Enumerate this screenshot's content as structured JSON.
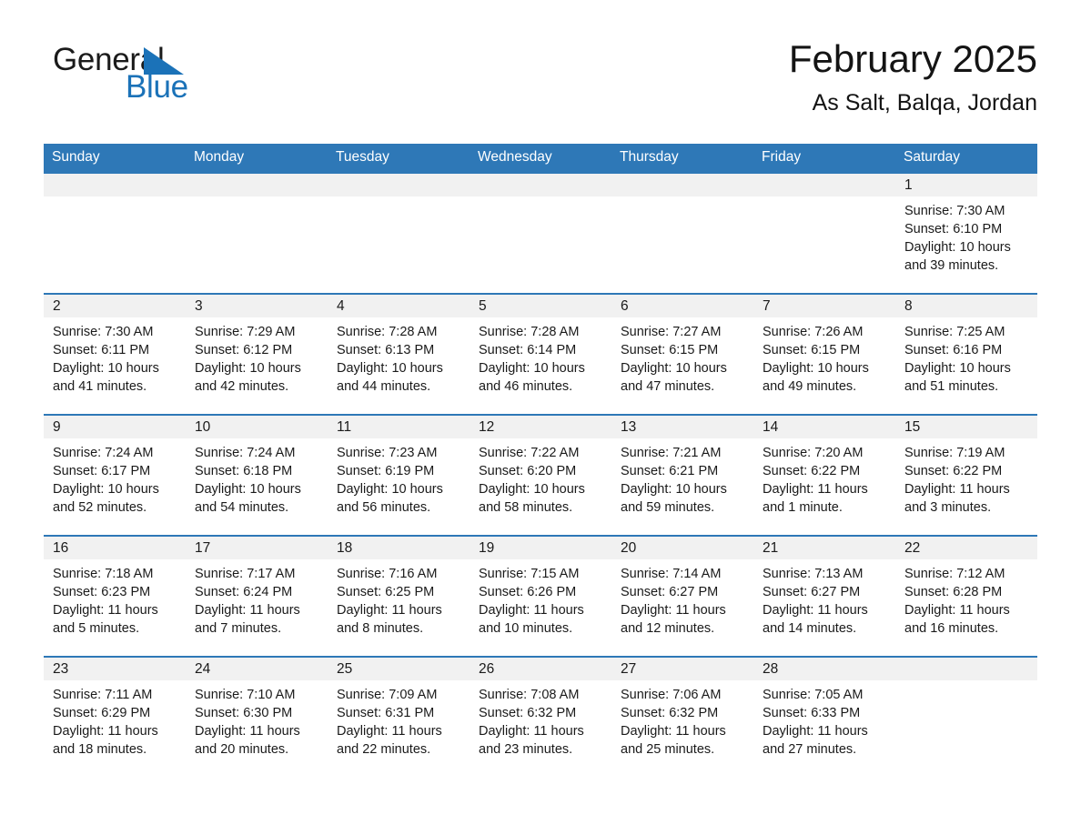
{
  "brand": {
    "name_part1": "General",
    "name_part2": "Blue",
    "triangle_color": "#1b72b8",
    "text_color": "#1b1b1b"
  },
  "header": {
    "title": "February 2025",
    "subtitle": "As Salt, Balqa, Jordan"
  },
  "theme": {
    "header_blue": "#2e78b7",
    "row_divider_blue": "#2e78b7",
    "daynum_band_gray": "#f1f1f1",
    "text_black": "#1a1a1a",
    "page_background": "#ffffff"
  },
  "weekday_headers": [
    "Sunday",
    "Monday",
    "Tuesday",
    "Wednesday",
    "Thursday",
    "Friday",
    "Saturday"
  ],
  "labels": {
    "sunrise_prefix": "Sunrise:",
    "sunset_prefix": "Sunset:",
    "daylight_prefix": "Daylight:"
  },
  "weeks": [
    [
      {
        "empty": true
      },
      {
        "empty": true
      },
      {
        "empty": true
      },
      {
        "empty": true
      },
      {
        "empty": true
      },
      {
        "empty": true
      },
      {
        "empty": false,
        "day": "1",
        "sunrise": "Sunrise: 7:30 AM",
        "sunset": "Sunset: 6:10 PM",
        "daylight_line1": "Daylight: 10 hours",
        "daylight_line2": "and 39 minutes."
      }
    ],
    [
      {
        "empty": false,
        "day": "2",
        "sunrise": "Sunrise: 7:30 AM",
        "sunset": "Sunset: 6:11 PM",
        "daylight_line1": "Daylight: 10 hours",
        "daylight_line2": "and 41 minutes."
      },
      {
        "empty": false,
        "day": "3",
        "sunrise": "Sunrise: 7:29 AM",
        "sunset": "Sunset: 6:12 PM",
        "daylight_line1": "Daylight: 10 hours",
        "daylight_line2": "and 42 minutes."
      },
      {
        "empty": false,
        "day": "4",
        "sunrise": "Sunrise: 7:28 AM",
        "sunset": "Sunset: 6:13 PM",
        "daylight_line1": "Daylight: 10 hours",
        "daylight_line2": "and 44 minutes."
      },
      {
        "empty": false,
        "day": "5",
        "sunrise": "Sunrise: 7:28 AM",
        "sunset": "Sunset: 6:14 PM",
        "daylight_line1": "Daylight: 10 hours",
        "daylight_line2": "and 46 minutes."
      },
      {
        "empty": false,
        "day": "6",
        "sunrise": "Sunrise: 7:27 AM",
        "sunset": "Sunset: 6:15 PM",
        "daylight_line1": "Daylight: 10 hours",
        "daylight_line2": "and 47 minutes."
      },
      {
        "empty": false,
        "day": "7",
        "sunrise": "Sunrise: 7:26 AM",
        "sunset": "Sunset: 6:15 PM",
        "daylight_line1": "Daylight: 10 hours",
        "daylight_line2": "and 49 minutes."
      },
      {
        "empty": false,
        "day": "8",
        "sunrise": "Sunrise: 7:25 AM",
        "sunset": "Sunset: 6:16 PM",
        "daylight_line1": "Daylight: 10 hours",
        "daylight_line2": "and 51 minutes."
      }
    ],
    [
      {
        "empty": false,
        "day": "9",
        "sunrise": "Sunrise: 7:24 AM",
        "sunset": "Sunset: 6:17 PM",
        "daylight_line1": "Daylight: 10 hours",
        "daylight_line2": "and 52 minutes."
      },
      {
        "empty": false,
        "day": "10",
        "sunrise": "Sunrise: 7:24 AM",
        "sunset": "Sunset: 6:18 PM",
        "daylight_line1": "Daylight: 10 hours",
        "daylight_line2": "and 54 minutes."
      },
      {
        "empty": false,
        "day": "11",
        "sunrise": "Sunrise: 7:23 AM",
        "sunset": "Sunset: 6:19 PM",
        "daylight_line1": "Daylight: 10 hours",
        "daylight_line2": "and 56 minutes."
      },
      {
        "empty": false,
        "day": "12",
        "sunrise": "Sunrise: 7:22 AM",
        "sunset": "Sunset: 6:20 PM",
        "daylight_line1": "Daylight: 10 hours",
        "daylight_line2": "and 58 minutes."
      },
      {
        "empty": false,
        "day": "13",
        "sunrise": "Sunrise: 7:21 AM",
        "sunset": "Sunset: 6:21 PM",
        "daylight_line1": "Daylight: 10 hours",
        "daylight_line2": "and 59 minutes."
      },
      {
        "empty": false,
        "day": "14",
        "sunrise": "Sunrise: 7:20 AM",
        "sunset": "Sunset: 6:22 PM",
        "daylight_line1": "Daylight: 11 hours",
        "daylight_line2": "and 1 minute."
      },
      {
        "empty": false,
        "day": "15",
        "sunrise": "Sunrise: 7:19 AM",
        "sunset": "Sunset: 6:22 PM",
        "daylight_line1": "Daylight: 11 hours",
        "daylight_line2": "and 3 minutes."
      }
    ],
    [
      {
        "empty": false,
        "day": "16",
        "sunrise": "Sunrise: 7:18 AM",
        "sunset": "Sunset: 6:23 PM",
        "daylight_line1": "Daylight: 11 hours",
        "daylight_line2": "and 5 minutes."
      },
      {
        "empty": false,
        "day": "17",
        "sunrise": "Sunrise: 7:17 AM",
        "sunset": "Sunset: 6:24 PM",
        "daylight_line1": "Daylight: 11 hours",
        "daylight_line2": "and 7 minutes."
      },
      {
        "empty": false,
        "day": "18",
        "sunrise": "Sunrise: 7:16 AM",
        "sunset": "Sunset: 6:25 PM",
        "daylight_line1": "Daylight: 11 hours",
        "daylight_line2": "and 8 minutes."
      },
      {
        "empty": false,
        "day": "19",
        "sunrise": "Sunrise: 7:15 AM",
        "sunset": "Sunset: 6:26 PM",
        "daylight_line1": "Daylight: 11 hours",
        "daylight_line2": "and 10 minutes."
      },
      {
        "empty": false,
        "day": "20",
        "sunrise": "Sunrise: 7:14 AM",
        "sunset": "Sunset: 6:27 PM",
        "daylight_line1": "Daylight: 11 hours",
        "daylight_line2": "and 12 minutes."
      },
      {
        "empty": false,
        "day": "21",
        "sunrise": "Sunrise: 7:13 AM",
        "sunset": "Sunset: 6:27 PM",
        "daylight_line1": "Daylight: 11 hours",
        "daylight_line2": "and 14 minutes."
      },
      {
        "empty": false,
        "day": "22",
        "sunrise": "Sunrise: 7:12 AM",
        "sunset": "Sunset: 6:28 PM",
        "daylight_line1": "Daylight: 11 hours",
        "daylight_line2": "and 16 minutes."
      }
    ],
    [
      {
        "empty": false,
        "day": "23",
        "sunrise": "Sunrise: 7:11 AM",
        "sunset": "Sunset: 6:29 PM",
        "daylight_line1": "Daylight: 11 hours",
        "daylight_line2": "and 18 minutes."
      },
      {
        "empty": false,
        "day": "24",
        "sunrise": "Sunrise: 7:10 AM",
        "sunset": "Sunset: 6:30 PM",
        "daylight_line1": "Daylight: 11 hours",
        "daylight_line2": "and 20 minutes."
      },
      {
        "empty": false,
        "day": "25",
        "sunrise": "Sunrise: 7:09 AM",
        "sunset": "Sunset: 6:31 PM",
        "daylight_line1": "Daylight: 11 hours",
        "daylight_line2": "and 22 minutes."
      },
      {
        "empty": false,
        "day": "26",
        "sunrise": "Sunrise: 7:08 AM",
        "sunset": "Sunset: 6:32 PM",
        "daylight_line1": "Daylight: 11 hours",
        "daylight_line2": "and 23 minutes."
      },
      {
        "empty": false,
        "day": "27",
        "sunrise": "Sunrise: 7:06 AM",
        "sunset": "Sunset: 6:32 PM",
        "daylight_line1": "Daylight: 11 hours",
        "daylight_line2": "and 25 minutes."
      },
      {
        "empty": false,
        "day": "28",
        "sunrise": "Sunrise: 7:05 AM",
        "sunset": "Sunset: 6:33 PM",
        "daylight_line1": "Daylight: 11 hours",
        "daylight_line2": "and 27 minutes."
      },
      {
        "empty": true
      }
    ]
  ]
}
